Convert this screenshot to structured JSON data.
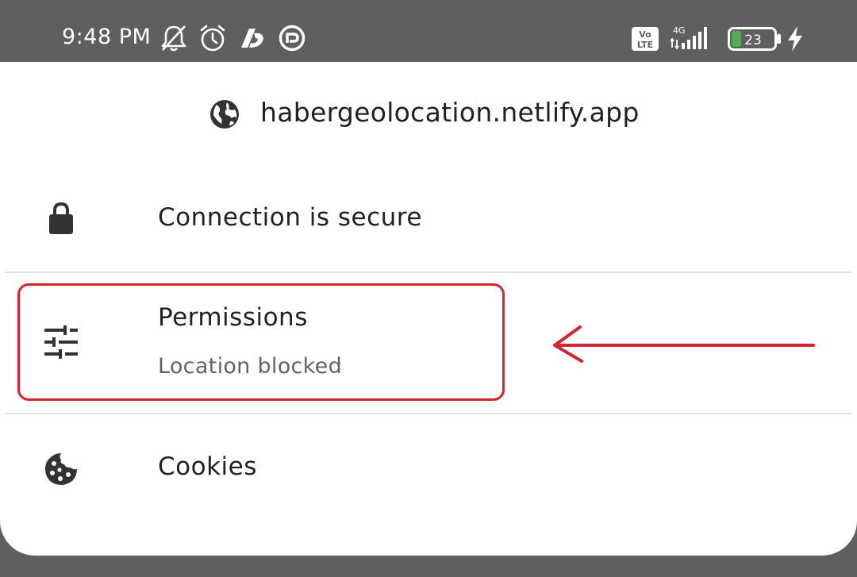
{
  "status_bar": {
    "time": "9:48 PM",
    "icons": [
      "bell-off-icon",
      "alarm-icon",
      "app-notification-icon",
      "vpn-icon",
      "volte-icon",
      "signal-4g-icon",
      "battery-icon",
      "charging-icon"
    ],
    "volte_label_top": "Vo",
    "volte_label_bottom": "LTE",
    "network_type": "4G",
    "battery_level": "23",
    "battery_fill_percent": 23,
    "battery_color": "#4caf50"
  },
  "site": {
    "icon": "globe-icon",
    "url": "habergeolocation.netlify.app"
  },
  "rows": [
    {
      "icon": "lock-icon",
      "title": "Connection is secure"
    },
    {
      "icon": "sliders-icon",
      "title": "Permissions",
      "subtitle": "Location blocked"
    },
    {
      "icon": "cookie-icon",
      "title": "Cookies"
    }
  ],
  "annotation": {
    "highlight_color": "#d6232d",
    "arrow_color": "#d6232d"
  }
}
